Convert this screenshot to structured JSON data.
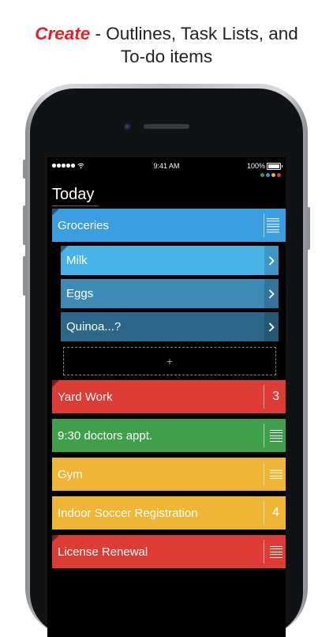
{
  "headline": {
    "emphasis": "Create",
    "rest_line1": " - Outlines, Task Lists, and",
    "line2": "To-do items"
  },
  "status_bar": {
    "time": "9:41 AM",
    "battery_percent": "100%",
    "dot_colors": [
      "#2f9e48",
      "#3d8fe0",
      "#f0b52c",
      "#e23b31"
    ]
  },
  "list_title": "Today",
  "rows": {
    "groceries": {
      "label": "Groceries",
      "color": "#3a9ee0"
    },
    "milk": {
      "label": "Milk",
      "color": "#47b3e6"
    },
    "eggs": {
      "label": "Eggs",
      "color": "#3c8ab5"
    },
    "quinoa": {
      "label": "Quinoa...?",
      "color": "#2c6688"
    },
    "add": {
      "label": "+"
    },
    "yard_work": {
      "label": "Yard Work",
      "count": "3",
      "color": "#dd3b33"
    },
    "doctors": {
      "label": "9:30 doctors appt.",
      "color": "#3f9f4a"
    },
    "gym": {
      "label": "Gym",
      "color": "#efb534"
    },
    "soccer": {
      "label": "Indoor Soccer Registration",
      "count": "4",
      "color": "#efb534"
    },
    "license": {
      "label": "License Renewal",
      "color": "#dd3b33"
    }
  }
}
